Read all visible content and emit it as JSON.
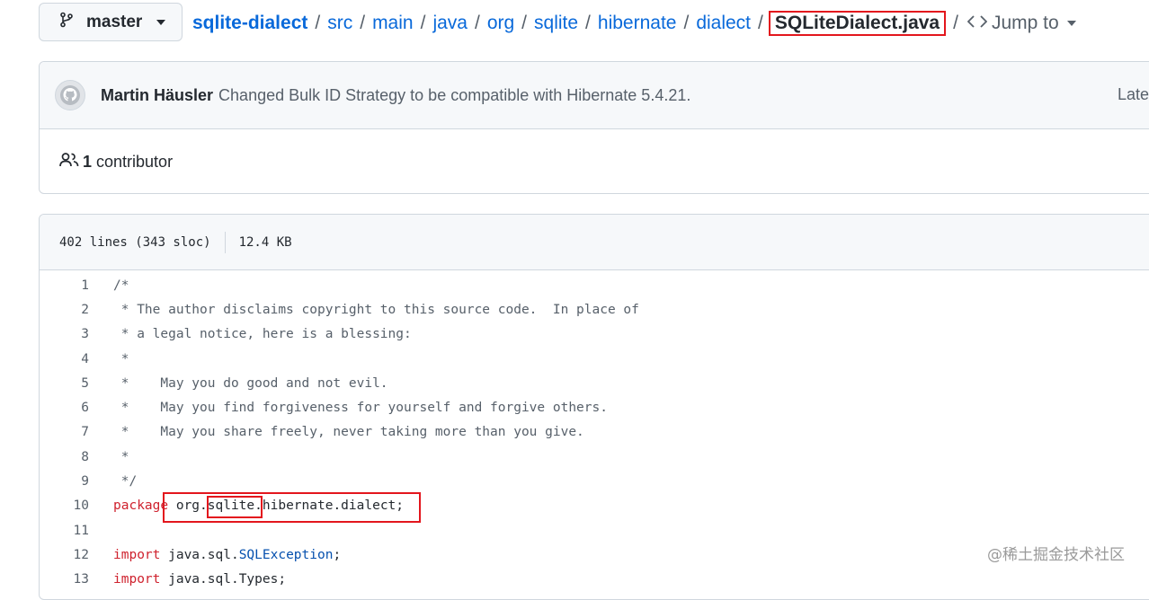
{
  "branch": {
    "label": "master"
  },
  "breadcrumb": {
    "repo": "sqlite-dialect",
    "dirs": [
      "src",
      "main",
      "java",
      "org",
      "sqlite",
      "hibernate",
      "dialect"
    ],
    "file": "SQLiteDialect.java",
    "jump_label": "Jump to"
  },
  "commit": {
    "author": "Martin Häusler",
    "message": "Changed Bulk ID Strategy to be compatible with Hibernate 5.4.21.",
    "latest": "Late"
  },
  "contributors": {
    "count": "1",
    "label": "contributor"
  },
  "file_info": {
    "lines": "402 lines (343 sloc)",
    "size": "12.4 KB"
  },
  "code_lines": [
    {
      "n": "1",
      "segs": [
        [
          "c",
          "/*"
        ]
      ]
    },
    {
      "n": "2",
      "segs": [
        [
          "c",
          " * The author disclaims copyright to this source code.  In place of"
        ]
      ]
    },
    {
      "n": "3",
      "segs": [
        [
          "c",
          " * a legal notice, here is a blessing:"
        ]
      ]
    },
    {
      "n": "4",
      "segs": [
        [
          "c",
          " *"
        ]
      ]
    },
    {
      "n": "5",
      "segs": [
        [
          "c",
          " *    May you do good and not evil."
        ]
      ]
    },
    {
      "n": "6",
      "segs": [
        [
          "c",
          " *    May you find forgiveness for yourself and forgive others."
        ]
      ]
    },
    {
      "n": "7",
      "segs": [
        [
          "c",
          " *    May you share freely, never taking more than you give."
        ]
      ]
    },
    {
      "n": "8",
      "segs": [
        [
          "c",
          " *"
        ]
      ]
    },
    {
      "n": "9",
      "segs": [
        [
          "c",
          " */"
        ]
      ]
    },
    {
      "n": "10",
      "segs": [
        [
          "k",
          "package"
        ],
        [
          "p",
          " org."
        ],
        [
          "p",
          "sqlite"
        ],
        [
          "p",
          ".hibernate.dialect;"
        ]
      ]
    },
    {
      "n": "11",
      "segs": []
    },
    {
      "n": "12",
      "segs": [
        [
          "k",
          "import"
        ],
        [
          "p",
          " java.sql."
        ],
        [
          "t",
          "SQLException"
        ],
        [
          "p",
          ";"
        ]
      ]
    },
    {
      "n": "13",
      "segs": [
        [
          "k",
          "import"
        ],
        [
          "p",
          " java.sql.Types;"
        ]
      ]
    }
  ],
  "watermark": "@稀土掘金技术社区",
  "colors": {
    "link": "#0969da",
    "highlight_box": "#e3161d",
    "keyword": "#cf222e",
    "type": "#0550ae",
    "comment": "#57606a"
  }
}
